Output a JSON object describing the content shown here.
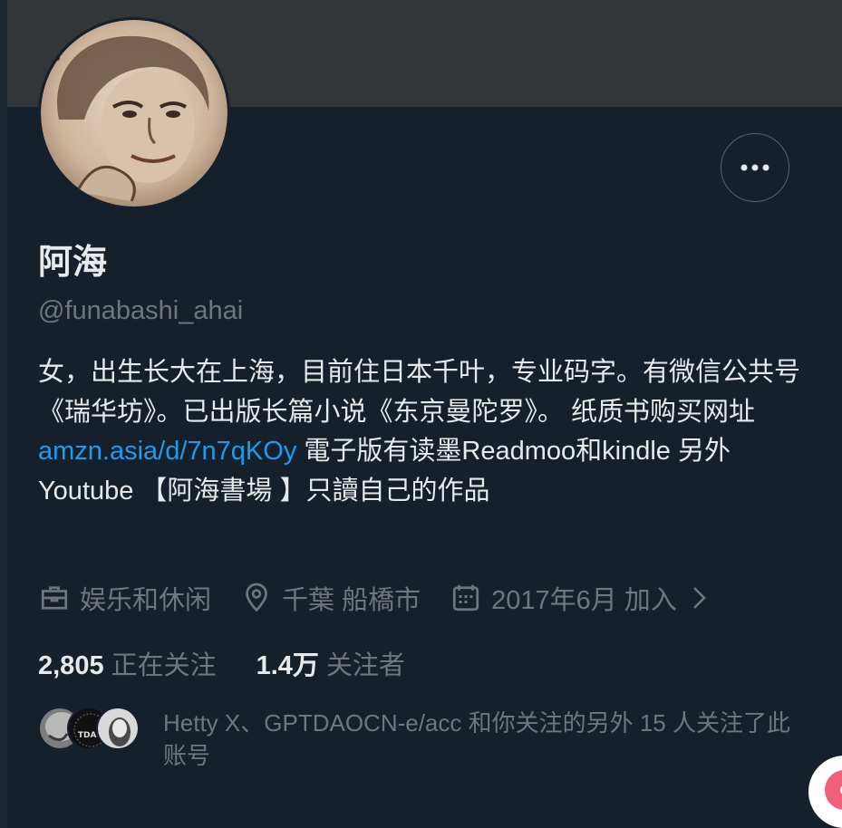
{
  "profile": {
    "name": "阿海",
    "handle": "@funabashi_ahai",
    "bio": {
      "text_before_link": "女，出生长大在上海，目前住日本千叶，专业码字。有微信公共号《瑞华坊》。已出版长篇小说《东京曼陀罗》。 纸质书购买网址",
      "link": "amzn.asia/d/7n7qKOy",
      "text_after_link": " 電子版有读墨Readmoo和kindle 另外Youtube 【阿海書場 】只讀自己的作品"
    },
    "meta": {
      "category": "娱乐和休闲",
      "location": "千葉 船橋市",
      "joined": "2017年6月 加入"
    },
    "stats": {
      "following_count": "2,805",
      "following_label": "正在关注",
      "followers_count": "1.4万",
      "followers_label": "关注者"
    },
    "followers_you_know": "Hetty X、GPTDAOCN-e/acc 和你关注的另外 15 人关注了此账号",
    "follower_avatar_2_text": "TDAO"
  },
  "icons": {
    "more": "more-horizontal-icon",
    "category": "briefcase-icon",
    "location": "location-pin-icon",
    "joined": "calendar-icon",
    "chevron": "chevron-right-icon"
  },
  "colors": {
    "background": "#15202b",
    "banner": "#333639",
    "link": "#1d9bf0",
    "secondary_text": "#71767b",
    "primary_text": "#e7e9ea"
  }
}
